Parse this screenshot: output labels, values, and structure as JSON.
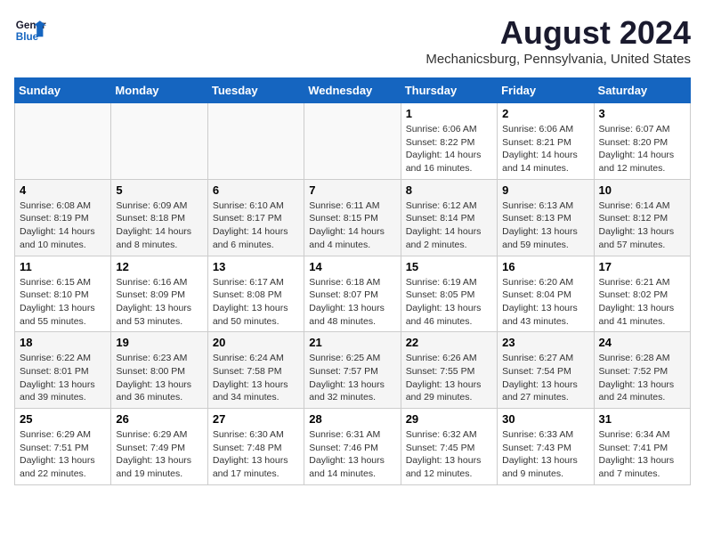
{
  "header": {
    "logo_line1": "General",
    "logo_line2": "Blue",
    "month_year": "August 2024",
    "location": "Mechanicsburg, Pennsylvania, United States"
  },
  "days_of_week": [
    "Sunday",
    "Monday",
    "Tuesday",
    "Wednesday",
    "Thursday",
    "Friday",
    "Saturday"
  ],
  "weeks": [
    [
      {
        "day": "",
        "info": ""
      },
      {
        "day": "",
        "info": ""
      },
      {
        "day": "",
        "info": ""
      },
      {
        "day": "",
        "info": ""
      },
      {
        "day": "1",
        "info": "Sunrise: 6:06 AM\nSunset: 8:22 PM\nDaylight: 14 hours\nand 16 minutes."
      },
      {
        "day": "2",
        "info": "Sunrise: 6:06 AM\nSunset: 8:21 PM\nDaylight: 14 hours\nand 14 minutes."
      },
      {
        "day": "3",
        "info": "Sunrise: 6:07 AM\nSunset: 8:20 PM\nDaylight: 14 hours\nand 12 minutes."
      }
    ],
    [
      {
        "day": "4",
        "info": "Sunrise: 6:08 AM\nSunset: 8:19 PM\nDaylight: 14 hours\nand 10 minutes."
      },
      {
        "day": "5",
        "info": "Sunrise: 6:09 AM\nSunset: 8:18 PM\nDaylight: 14 hours\nand 8 minutes."
      },
      {
        "day": "6",
        "info": "Sunrise: 6:10 AM\nSunset: 8:17 PM\nDaylight: 14 hours\nand 6 minutes."
      },
      {
        "day": "7",
        "info": "Sunrise: 6:11 AM\nSunset: 8:15 PM\nDaylight: 14 hours\nand 4 minutes."
      },
      {
        "day": "8",
        "info": "Sunrise: 6:12 AM\nSunset: 8:14 PM\nDaylight: 14 hours\nand 2 minutes."
      },
      {
        "day": "9",
        "info": "Sunrise: 6:13 AM\nSunset: 8:13 PM\nDaylight: 13 hours\nand 59 minutes."
      },
      {
        "day": "10",
        "info": "Sunrise: 6:14 AM\nSunset: 8:12 PM\nDaylight: 13 hours\nand 57 minutes."
      }
    ],
    [
      {
        "day": "11",
        "info": "Sunrise: 6:15 AM\nSunset: 8:10 PM\nDaylight: 13 hours\nand 55 minutes."
      },
      {
        "day": "12",
        "info": "Sunrise: 6:16 AM\nSunset: 8:09 PM\nDaylight: 13 hours\nand 53 minutes."
      },
      {
        "day": "13",
        "info": "Sunrise: 6:17 AM\nSunset: 8:08 PM\nDaylight: 13 hours\nand 50 minutes."
      },
      {
        "day": "14",
        "info": "Sunrise: 6:18 AM\nSunset: 8:07 PM\nDaylight: 13 hours\nand 48 minutes."
      },
      {
        "day": "15",
        "info": "Sunrise: 6:19 AM\nSunset: 8:05 PM\nDaylight: 13 hours\nand 46 minutes."
      },
      {
        "day": "16",
        "info": "Sunrise: 6:20 AM\nSunset: 8:04 PM\nDaylight: 13 hours\nand 43 minutes."
      },
      {
        "day": "17",
        "info": "Sunrise: 6:21 AM\nSunset: 8:02 PM\nDaylight: 13 hours\nand 41 minutes."
      }
    ],
    [
      {
        "day": "18",
        "info": "Sunrise: 6:22 AM\nSunset: 8:01 PM\nDaylight: 13 hours\nand 39 minutes."
      },
      {
        "day": "19",
        "info": "Sunrise: 6:23 AM\nSunset: 8:00 PM\nDaylight: 13 hours\nand 36 minutes."
      },
      {
        "day": "20",
        "info": "Sunrise: 6:24 AM\nSunset: 7:58 PM\nDaylight: 13 hours\nand 34 minutes."
      },
      {
        "day": "21",
        "info": "Sunrise: 6:25 AM\nSunset: 7:57 PM\nDaylight: 13 hours\nand 32 minutes."
      },
      {
        "day": "22",
        "info": "Sunrise: 6:26 AM\nSunset: 7:55 PM\nDaylight: 13 hours\nand 29 minutes."
      },
      {
        "day": "23",
        "info": "Sunrise: 6:27 AM\nSunset: 7:54 PM\nDaylight: 13 hours\nand 27 minutes."
      },
      {
        "day": "24",
        "info": "Sunrise: 6:28 AM\nSunset: 7:52 PM\nDaylight: 13 hours\nand 24 minutes."
      }
    ],
    [
      {
        "day": "25",
        "info": "Sunrise: 6:29 AM\nSunset: 7:51 PM\nDaylight: 13 hours\nand 22 minutes."
      },
      {
        "day": "26",
        "info": "Sunrise: 6:29 AM\nSunset: 7:49 PM\nDaylight: 13 hours\nand 19 minutes."
      },
      {
        "day": "27",
        "info": "Sunrise: 6:30 AM\nSunset: 7:48 PM\nDaylight: 13 hours\nand 17 minutes."
      },
      {
        "day": "28",
        "info": "Sunrise: 6:31 AM\nSunset: 7:46 PM\nDaylight: 13 hours\nand 14 minutes."
      },
      {
        "day": "29",
        "info": "Sunrise: 6:32 AM\nSunset: 7:45 PM\nDaylight: 13 hours\nand 12 minutes."
      },
      {
        "day": "30",
        "info": "Sunrise: 6:33 AM\nSunset: 7:43 PM\nDaylight: 13 hours\nand 9 minutes."
      },
      {
        "day": "31",
        "info": "Sunrise: 6:34 AM\nSunset: 7:41 PM\nDaylight: 13 hours\nand 7 minutes."
      }
    ]
  ]
}
